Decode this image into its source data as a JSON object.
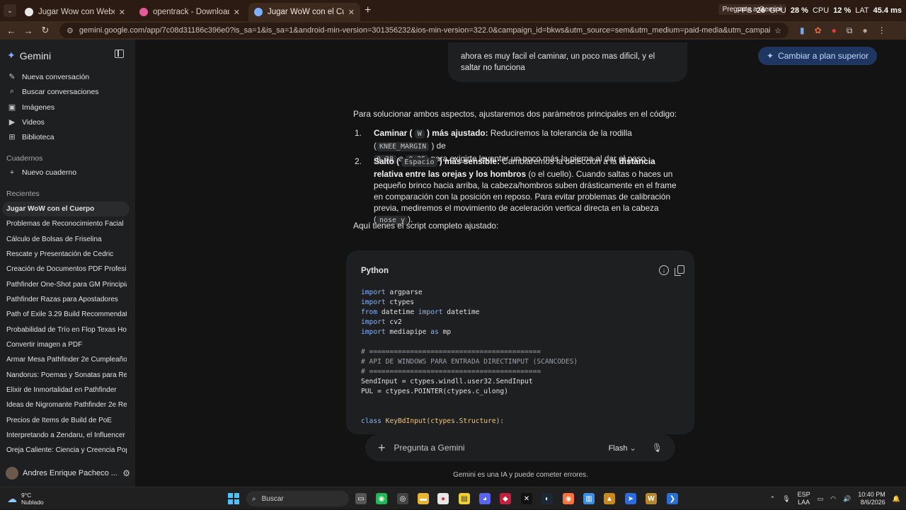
{
  "browser": {
    "tabs": [
      {
        "title": "Jugar Wow con Webcam",
        "favicon_color": "#e8e8e8",
        "active": false
      },
      {
        "title": "opentrack - Download Free He...",
        "favicon_color": "#e45a9b",
        "active": false
      },
      {
        "title": "Jugar WoW con el Cuerpo - Ge...",
        "favicon_color": "#7fb0ff",
        "active": true
      }
    ],
    "url": "gemini.google.com/app/7c08d31186c396e0?is_sa=1&is_sa=1&android-min-version=301356232&ios-min-version=322.0&campaign_id=bkws&utm_source=sem&utm_medium=paid-media&utm_campaign=bkws&pt=9008&mt=8&ct=p...",
    "overlay": {
      "fps_label": "FPS",
      "fps": "26",
      "gpu_label": "GPU",
      "gpu": "28 %",
      "cpu_label": "CPU",
      "cpu": "12 %",
      "lat_label": "LAT",
      "lat": "45.4 ms"
    },
    "floating_title": "Pregunta a Gemini"
  },
  "sidebar": {
    "brand": "Gemini",
    "nav": [
      {
        "label": "Nueva conversación",
        "icon": "edit-icon"
      },
      {
        "label": "Buscar conversaciones",
        "icon": "search-icon"
      },
      {
        "label": "Imágenes",
        "icon": "image-icon"
      },
      {
        "label": "Videos",
        "icon": "video-icon"
      },
      {
        "label": "Biblioteca",
        "icon": "library-icon"
      }
    ],
    "notebooks_title": "Cuadernos",
    "new_notebook": "Nuevo cuaderno",
    "recents_title": "Recientes",
    "recents": [
      "Jugar WoW con el Cuerpo",
      "Problemas de Reconocimiento Facial",
      "Cálculo de Bolsas de Friselina",
      "Rescate y Presentación de Cedric",
      "Creación de Documentos PDF Profesio...",
      "Pathfinder One-Shot para GM Principia...",
      "Pathfinder Razas para Apostadores",
      "Path of Exile 3.29 Build Recommendati...",
      "Probabilidad de Trío en Flop Texas Hold...",
      "Convertir imagen a PDF",
      "Armar Mesa Pathfinder 2e Cumpleaños",
      "Nandorus: Poemas y Sonatas para Reci...",
      "Elixir de Inmortalidad en Pathfinder",
      "Ideas de Nigromante Pathfinder 2e Re...",
      "Precios de Items de Build de PoE",
      "Interpretando a Zendaru, el Influencer ...",
      "Oreja Caliente: Ciencia y Creencia Pop..."
    ],
    "user": "Andres Enrique Pacheco ..."
  },
  "main": {
    "upgrade": "Cambiar a plan superior",
    "user_message": "ahora es muy facil el caminar, un poco mas dificil, y el saltar no funciona",
    "intro": "Para solucionar ambos aspectos, ajustaremos dos parámetros principales en el código:",
    "item1": {
      "num": "1.",
      "bold_a": "Caminar (",
      "key": "W",
      "bold_b": ") más ajustado:",
      "text_a": " Reduciremos la tolerancia de la rodilla (",
      "const": "KNEE_MARGIN",
      "text_b": ") de",
      "from": "0.38",
      "a": "a",
      "to": "0.25",
      "text_c": "para exigirte levantar un poco más la pierna al dar el paso."
    },
    "item2": {
      "num": "2.",
      "bold_a": "Salto (",
      "key": "Espacio",
      "bold_b": ") más sensible:",
      "text_a": " Cambiaremos la detección a la ",
      "bold_c": "distancia relativa entre las orejas y los hombros",
      "text_b": " (o el cuello). Cuando saltas o haces un pequeño brinco hacia arriba, la cabeza/hombros suben drásticamente en el frame en comparación con la posición en reposo. Para evitar problemas de calibración previa, mediremos el movimiento de aceleración vertical directa en la cabeza (",
      "const": "nose_y",
      "text_c": ")."
    },
    "outro": "Aquí tienes el script completo ajustado:",
    "code_lang": "Python",
    "input_placeholder": "Pregunta a Gemini",
    "model": "Flash",
    "disclaimer": "Gemini es una IA y puede cometer errores."
  },
  "taskbar": {
    "temp": "9°C",
    "weather": "Nublado",
    "search": "Buscar",
    "lang_a": "ESP",
    "lang_b": "LAA",
    "time": "10:40 PM",
    "date": "8/6/2026"
  }
}
